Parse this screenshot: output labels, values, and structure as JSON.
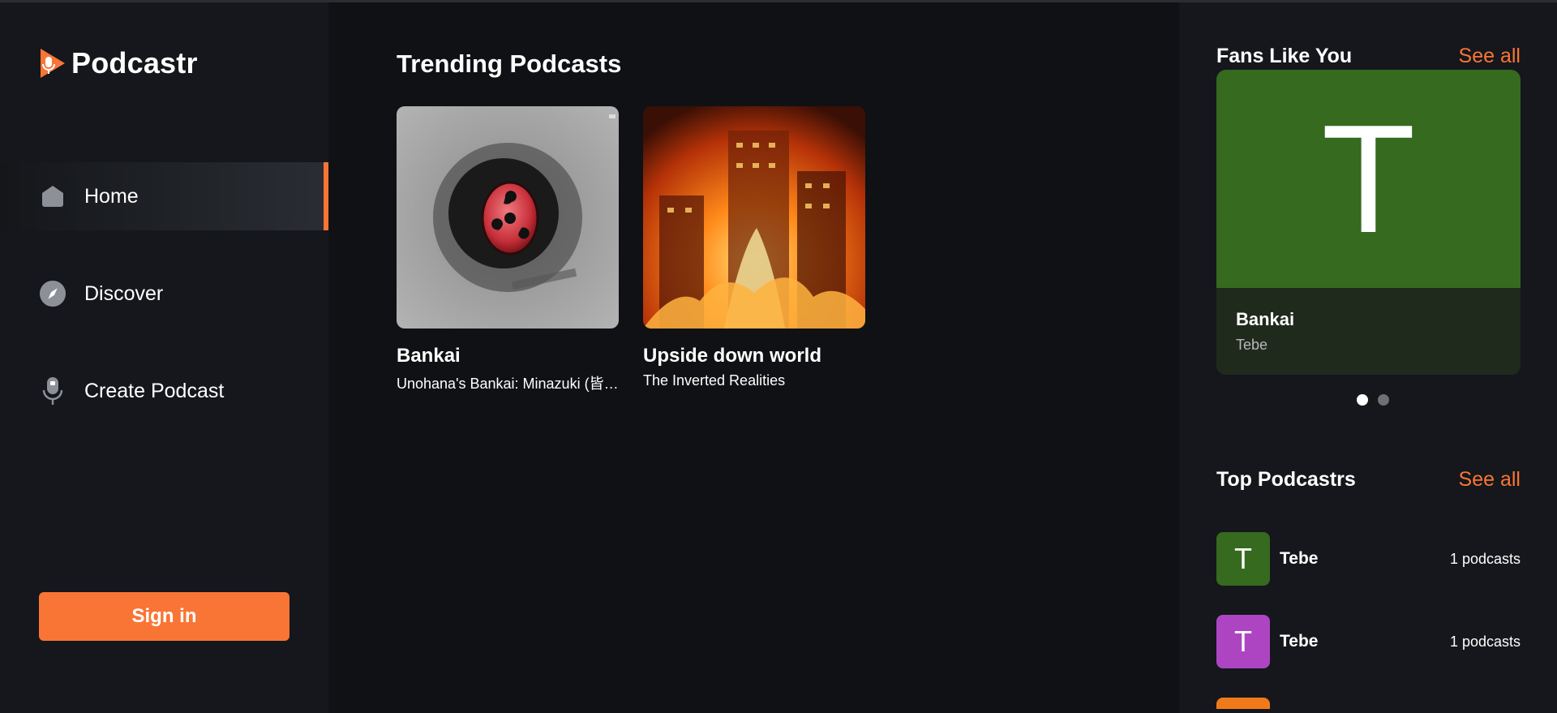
{
  "app": {
    "name": "Podcastr"
  },
  "nav": {
    "items": [
      {
        "label": "Home",
        "icon": "home-icon",
        "active": true
      },
      {
        "label": "Discover",
        "icon": "compass-icon",
        "active": false
      },
      {
        "label": "Create Podcast",
        "icon": "microphone-icon",
        "active": false
      }
    ]
  },
  "auth": {
    "signin_label": "Sign in"
  },
  "trending": {
    "title": "Trending Podcasts",
    "cards": [
      {
        "title": "Bankai",
        "subtitle": "Unohana's Bankai: Minazuki (皆尽)"
      },
      {
        "title": "Upside down world",
        "subtitle": "The Inverted Realities"
      }
    ]
  },
  "fans": {
    "title": "Fans Like You",
    "see_all": "See all",
    "card": {
      "letter": "T",
      "name": "Bankai",
      "author": "Tebe",
      "color": "#356a1f"
    },
    "slides": 2,
    "active_slide": 0
  },
  "top_podcastrs": {
    "title": "Top Podcastrs",
    "see_all": "See all",
    "items": [
      {
        "letter": "T",
        "name": "Tebe",
        "count": "1 podcasts",
        "color": "#356a1f"
      },
      {
        "letter": "T",
        "name": "Tebe",
        "count": "1 podcasts",
        "color": "#ad45c2"
      }
    ],
    "partial_color": "#f07a1a"
  },
  "colors": {
    "accent": "#f97535",
    "background": "#101114",
    "panel": "#15171c"
  }
}
